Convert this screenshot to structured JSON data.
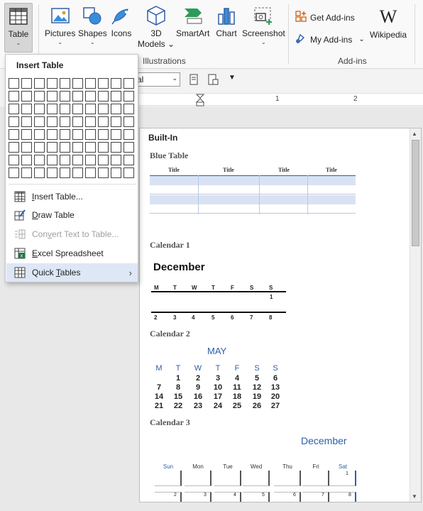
{
  "ribbon": {
    "table_label": "Table",
    "pictures_label": "Pictures",
    "shapes_label": "Shapes",
    "icons_label": "Icons",
    "models_label_1": "3D",
    "models_label_2": "Models",
    "smartart_label": "SmartArt",
    "chart_label": "Chart",
    "screenshot_label": "Screenshot",
    "illustrations_group": "Illustrations",
    "get_addins_label": "Get Add-ins",
    "my_addins_label": "My Add-ins",
    "addins_group": "Add-ins",
    "wikipedia_label": "Wikipedia",
    "wiki_glyph": "W"
  },
  "toolbar2": {
    "font_value": "al"
  },
  "ruler": {
    "n1": "1",
    "n2": "2"
  },
  "menu": {
    "title": "Insert Table",
    "items": [
      {
        "pre": "",
        "key": "I",
        "rest": "nsert Table...",
        "icon": "insert-table-icon"
      },
      {
        "pre": "",
        "key": "D",
        "rest": "raw Table",
        "icon": "draw-table-icon"
      },
      {
        "pre": "Con",
        "key": "v",
        "rest": "ert Text to Table...",
        "icon": "convert-text-icon"
      },
      {
        "pre": "",
        "key": "E",
        "rest": "xcel Spreadsheet",
        "icon": "excel-icon"
      },
      {
        "pre": "Quick ",
        "key": "T",
        "rest": "ables",
        "icon": "quick-tables-icon"
      }
    ]
  },
  "gallery": {
    "builtin_label": "Built-In",
    "blue_table": {
      "name": "Blue Table",
      "headers": [
        "Title",
        "Title",
        "Title",
        "Title"
      ]
    },
    "calendar1": {
      "name": "Calendar 1",
      "month": "December",
      "days": [
        "M",
        "T",
        "W",
        "T",
        "F",
        "S",
        "S"
      ],
      "row1": [
        "",
        "",
        "",
        "",
        "",
        "",
        "1"
      ],
      "row2": [
        "2",
        "3",
        "4",
        "5",
        "6",
        "7",
        "8"
      ]
    },
    "calendar2": {
      "name": "Calendar 2",
      "month": "MAY",
      "days": [
        "M",
        "T",
        "W",
        "T",
        "F",
        "S",
        "S"
      ],
      "weeks": [
        [
          "",
          "1",
          "2",
          "3",
          "4",
          "5",
          "6"
        ],
        [
          "7",
          "8",
          "9",
          "10",
          "11",
          "12",
          "13"
        ],
        [
          "14",
          "15",
          "16",
          "17",
          "18",
          "19",
          "20"
        ],
        [
          "21",
          "22",
          "23",
          "24",
          "25",
          "26",
          "27"
        ]
      ]
    },
    "calendar3": {
      "name": "Calendar 3",
      "month": "December",
      "days": [
        "Sun",
        "Mon",
        "Tue",
        "Wed",
        "Thu",
        "Fri",
        "Sat"
      ],
      "first_num": "1",
      "second_row": [
        "2",
        "3",
        "4",
        "5",
        "6",
        "7",
        "8"
      ]
    }
  },
  "colors": {
    "accent_blue": "#2e5ea8",
    "blue_row": "#d9e2f3",
    "menu_highlight": "#dde7f6"
  }
}
